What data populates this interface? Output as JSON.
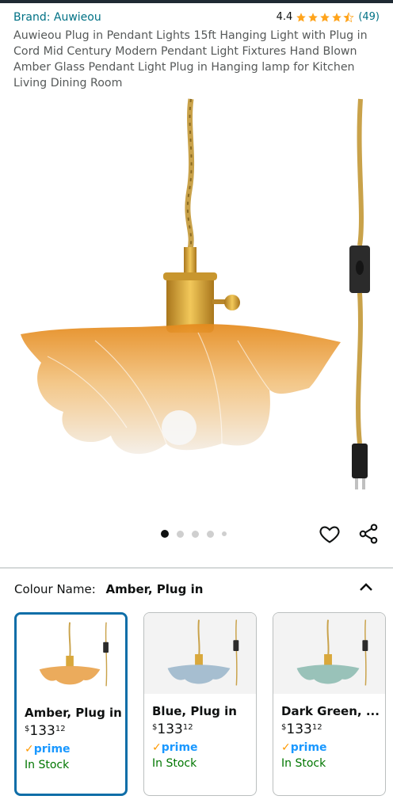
{
  "header": {
    "brand": "Brand: Auwieou",
    "rating": "4.4",
    "rating_stars": 4.4,
    "review_count": "(49)"
  },
  "product": {
    "title": "Auwieou Plug in Pendant Lights 15ft Hanging Light with Plug in Cord Mid Century Modern Pendant Light Fixtures Hand Blown Amber Glass Pendant Light Plug in Hanging lamp for Kitchen Living Dining Room"
  },
  "gallery": {
    "current_index": 1,
    "dot_count": 5
  },
  "colour": {
    "label": "Colour Name:",
    "selected": "Amber, Plug in",
    "options": [
      {
        "name": "Amber, Plug in",
        "currency": "$",
        "whole": "133",
        "fraction": "12",
        "prime": "prime",
        "stock": "In Stock",
        "shade": "#E9A24A"
      },
      {
        "name": "Blue, Plug in",
        "currency": "$",
        "whole": "133",
        "fraction": "12",
        "prime": "prime",
        "stock": "In Stock",
        "shade": "#9DB8CC"
      },
      {
        "name": "Dark Green, ...",
        "currency": "$",
        "whole": "133",
        "fraction": "12",
        "prime": "prime",
        "stock": "In Stock",
        "shade": "#8FBDB3"
      }
    ]
  },
  "colors": {
    "link": "#007185",
    "star": "#FFA41C",
    "prime": "#1A98FF",
    "in_stock": "#007600",
    "selected_border": "#0F6EA8"
  },
  "icons": [
    "star-icon",
    "heart-icon",
    "share-icon",
    "chevron-up-icon",
    "prime-check-icon"
  ]
}
